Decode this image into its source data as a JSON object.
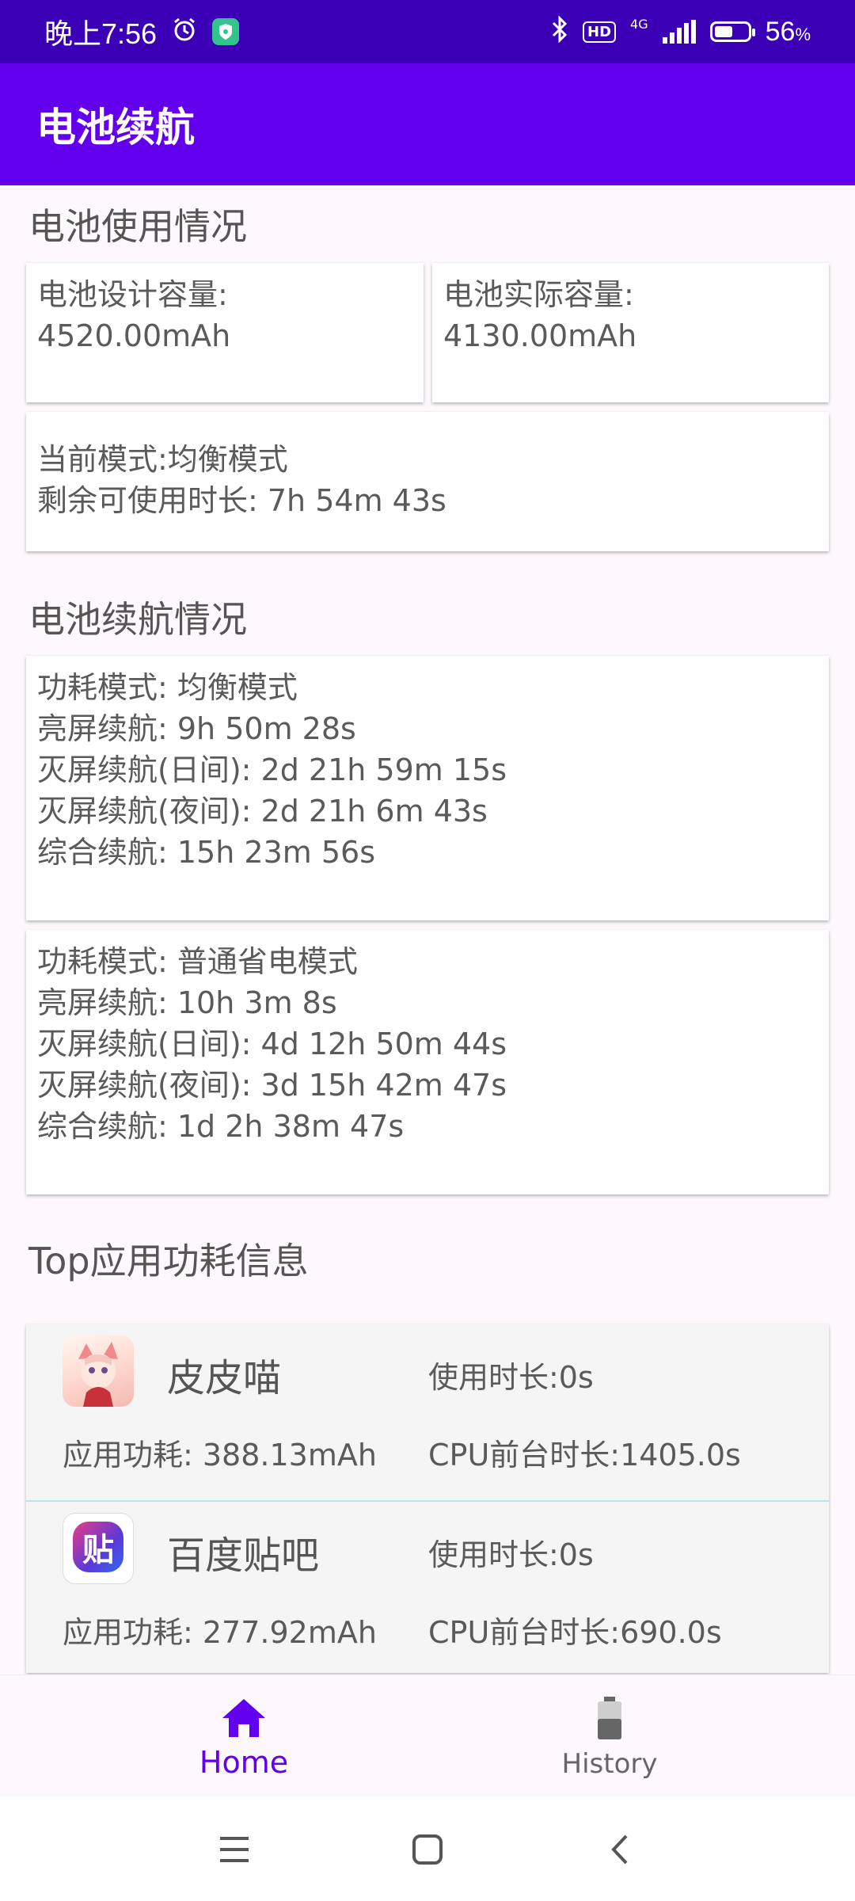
{
  "status_bar": {
    "time": "晚上7:56",
    "network": "4G",
    "hd": "HD",
    "battery_percent": "56",
    "battery_unit": "%",
    "battery_level": 0.56
  },
  "app_bar": {
    "title": "电池续航"
  },
  "usage_section": {
    "title": "电池使用情况",
    "design_capacity_label": "电池设计容量:",
    "design_capacity_value": "4520.00mAh",
    "actual_capacity_label": "电池实际容量:",
    "actual_capacity_value": "4130.00mAh",
    "current_mode": "当前模式:均衡模式",
    "remaining_time": "剩余可使用时长: 7h 54m 43s"
  },
  "endurance_section": {
    "title": "电池续航情况",
    "cards": [
      {
        "mode": "功耗模式: 均衡模式",
        "screen_on": "亮屏续航: 9h 50m 28s",
        "screen_off_day": "灭屏续航(日间): 2d 21h 59m 15s",
        "screen_off_night": "灭屏续航(夜间): 2d 21h 6m 43s",
        "overall": "综合续航: 15h 23m 56s"
      },
      {
        "mode": "功耗模式: 普通省电模式",
        "screen_on": "亮屏续航: 10h 3m 8s",
        "screen_off_day": "灭屏续航(日间): 4d 12h 50m 44s",
        "screen_off_night": "灭屏续航(夜间): 3d 15h 42m 47s",
        "overall": "综合续航: 1d 2h 38m 47s"
      }
    ]
  },
  "top_apps_section": {
    "title": "Top应用功耗信息",
    "apps": [
      {
        "name": "皮皮喵",
        "usage": "使用时长:0s",
        "power": "应用功耗: 388.13mAh",
        "cpu": "CPU前台时长:1405.0s"
      },
      {
        "name": "百度贴吧",
        "icon_text": "贴",
        "usage": "使用时长:0s",
        "power": "应用功耗: 277.92mAh",
        "cpu": "CPU前台时长:690.0s"
      }
    ]
  },
  "bottom_nav": {
    "items": [
      {
        "label": "Home",
        "icon": "home-icon",
        "active": true
      },
      {
        "label": "History",
        "icon": "battery-icon",
        "active": false
      }
    ]
  },
  "colors": {
    "status_bar": "#3b00b6",
    "app_bar": "#6200ee",
    "accent": "#6200ee"
  }
}
